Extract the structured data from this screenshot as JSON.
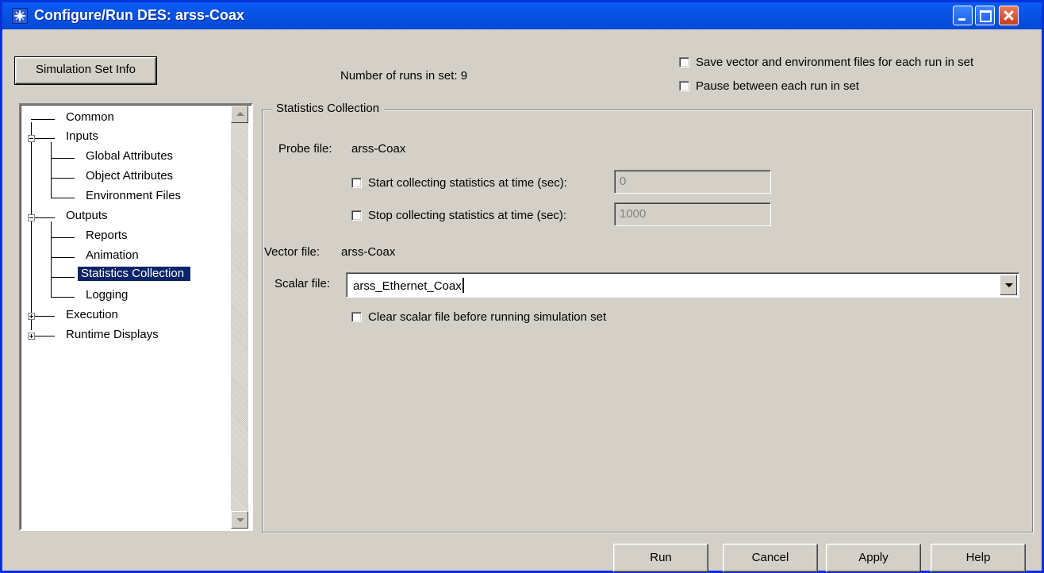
{
  "window": {
    "title": "Configure/Run DES: arss-Coax",
    "icon": "opnet-star-icon"
  },
  "top": {
    "sim_set_info_label": "Simulation Set Info",
    "sim_set_info_accel": "i",
    "runs_label": "Number of runs in set:",
    "runs_count": "9",
    "save_vector_label": "Save vector and environment files for each run in set",
    "pause_label": "Pause between each run in set"
  },
  "tree": {
    "items": [
      {
        "label": "Common"
      },
      {
        "label": "Inputs"
      },
      {
        "label": "Global Attributes"
      },
      {
        "label": "Object Attributes"
      },
      {
        "label": "Environment Files"
      },
      {
        "label": "Outputs"
      },
      {
        "label": "Reports"
      },
      {
        "label": "Animation"
      },
      {
        "label": "Statistics Collection"
      },
      {
        "label": "Logging"
      },
      {
        "label": "Execution"
      },
      {
        "label": "Runtime Displays"
      }
    ],
    "selected": "Statistics Collection"
  },
  "panel": {
    "title": "Statistics Collection",
    "probe_label": "Probe file:",
    "probe_value": "arss-Coax",
    "start_label": "Start collecting statistics at time (sec):",
    "start_value": "0",
    "stop_label": "Stop collecting statistics at time (sec):",
    "stop_value": "1000",
    "vector_label": "Vector file:",
    "vector_value": "arss-Coax",
    "scalar_label": "Scalar file:",
    "scalar_value": "arss_Ethernet_Coax",
    "clear_label": "Clear scalar file before running simulation set"
  },
  "buttons": {
    "run": "Run",
    "cancel": "Cancel",
    "apply": "Apply",
    "help": "Help"
  }
}
